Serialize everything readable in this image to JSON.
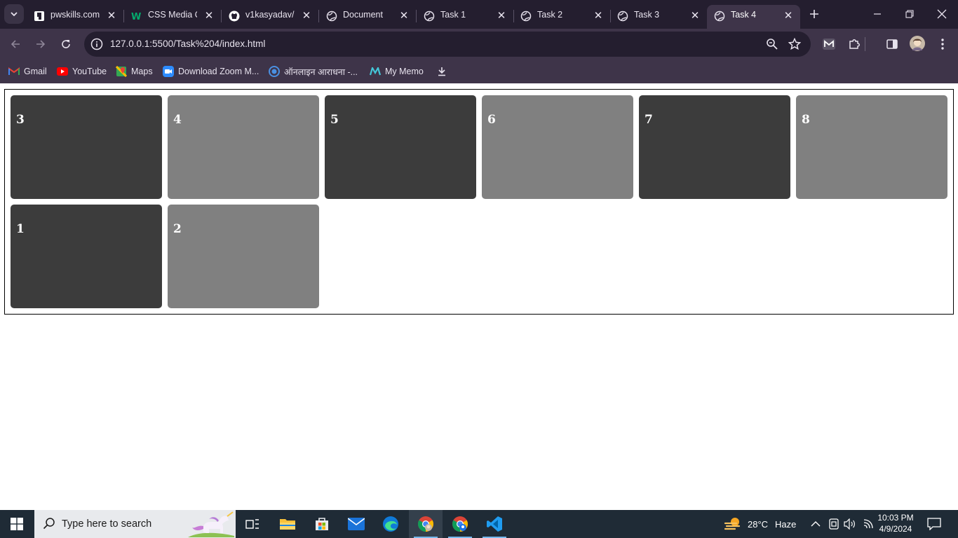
{
  "browser": {
    "tabs": [
      {
        "title": "pwskills.com",
        "favicon": "pwskills-icon",
        "active": false
      },
      {
        "title": "CSS Media Q",
        "favicon": "w3schools-icon",
        "active": false
      },
      {
        "title": "v1kasyadav/",
        "favicon": "github-icon",
        "active": false
      },
      {
        "title": "Document",
        "favicon": "globe-icon",
        "active": false
      },
      {
        "title": "Task 1",
        "favicon": "globe-icon",
        "active": false
      },
      {
        "title": "Task 2",
        "favicon": "globe-icon",
        "active": false
      },
      {
        "title": "Task 3",
        "favicon": "globe-icon",
        "active": false
      },
      {
        "title": "Task 4",
        "favicon": "globe-icon",
        "active": true
      }
    ],
    "url": "127.0.0.1:5500/Task%204/index.html",
    "bookmarks": [
      {
        "label": "Gmail",
        "icon": "gmail-icon"
      },
      {
        "label": "YouTube",
        "icon": "youtube-icon"
      },
      {
        "label": "Maps",
        "icon": "maps-icon"
      },
      {
        "label": "Download Zoom M...",
        "icon": "zoom-icon"
      },
      {
        "label": "ऑनलाइन आराधना -...",
        "icon": "aradhana-icon"
      },
      {
        "label": "My Memo",
        "icon": "memo-icon"
      }
    ],
    "colors": {
      "tabstrip": "#241e2f",
      "toolbar": "#3e3449",
      "text": "#e8e3ee"
    }
  },
  "page": {
    "boxes": [
      {
        "label": "3",
        "shade": "dark"
      },
      {
        "label": "4",
        "shade": "light"
      },
      {
        "label": "5",
        "shade": "dark"
      },
      {
        "label": "6",
        "shade": "light"
      },
      {
        "label": "7",
        "shade": "dark"
      },
      {
        "label": "8",
        "shade": "light"
      },
      {
        "label": "1",
        "shade": "dark"
      },
      {
        "label": "2",
        "shade": "light"
      }
    ],
    "colors": {
      "dark": "#3c3c3c",
      "light": "#808080",
      "label": "#ffffff"
    }
  },
  "taskbar": {
    "search_placeholder": "Type here to search",
    "weather_temp": "28°C",
    "weather_desc": "Haze",
    "time": "10:03 PM",
    "date": "4/9/2024",
    "apps": [
      "task-view-icon",
      "file-explorer-icon",
      "microsoft-store-icon",
      "mail-icon",
      "edge-icon",
      "chrome-icon",
      "chrome-profile-icon",
      "vscode-icon"
    ]
  }
}
